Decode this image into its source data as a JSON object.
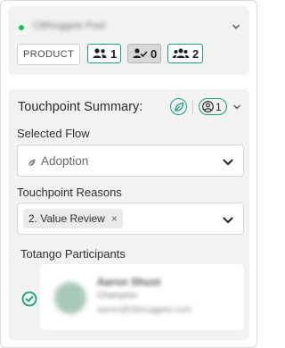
{
  "colors": {
    "accent": "#1a9e7c",
    "status_dot": "#1ec05a"
  },
  "account": {
    "name": "CBNuggets Pool",
    "product_label": "PRODUCT",
    "counts": [
      {
        "icon": "users-icon",
        "value": "1"
      },
      {
        "icon": "user-check-icon",
        "value": "0"
      },
      {
        "icon": "group-icon",
        "value": "2"
      }
    ]
  },
  "summary": {
    "title": "Touchpoint Summary:",
    "participants_count": "1",
    "flow": {
      "label": "Selected Flow",
      "value": "Adoption"
    },
    "reasons": {
      "label": "Touchpoint Reasons",
      "tag": "2. Value Review",
      "remove_glyph": "×"
    },
    "participants": {
      "label": "Totango Participants",
      "person": {
        "name": "Aaron Shust",
        "role": "Champion",
        "email": "aaron@cbtnuggets.com"
      }
    }
  }
}
